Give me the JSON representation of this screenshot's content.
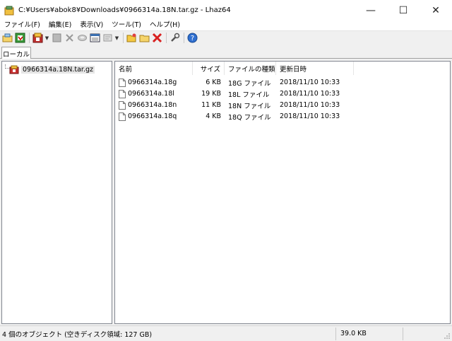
{
  "window": {
    "title": "C:¥Users¥abok8¥Downloads¥0966314a.18N.tar.gz - Lhaz64",
    "minimize": "—",
    "maximize": "☐",
    "close": "✕"
  },
  "menu": [
    "ファイル(F)",
    "編集(E)",
    "表示(V)",
    "ツール(T)",
    "ヘルプ(H)"
  ],
  "tabs": [
    "ローカル"
  ],
  "tree": {
    "root_label": "0966314a.18N.tar.gz"
  },
  "list": {
    "columns": [
      "名前",
      "サイズ",
      "ファイルの種類",
      "更新日時"
    ],
    "rows": [
      {
        "name": "0966314a.18g",
        "size": "6 KB",
        "type": "18G ファイル",
        "date": "2018/11/10 10:33"
      },
      {
        "name": "0966314a.18l",
        "size": "19 KB",
        "type": "18L ファイル",
        "date": "2018/11/10 10:33"
      },
      {
        "name": "0966314a.18n",
        "size": "11 KB",
        "type": "18N ファイル",
        "date": "2018/11/10 10:33"
      },
      {
        "name": "0966314a.18q",
        "size": "4 KB",
        "type": "18Q ファイル",
        "date": "2018/11/10 10:33"
      }
    ]
  },
  "status": {
    "objects": "4 個のオブジェクト (空きディスク領域: 127 GB)",
    "total_size": "39.0 KB"
  }
}
